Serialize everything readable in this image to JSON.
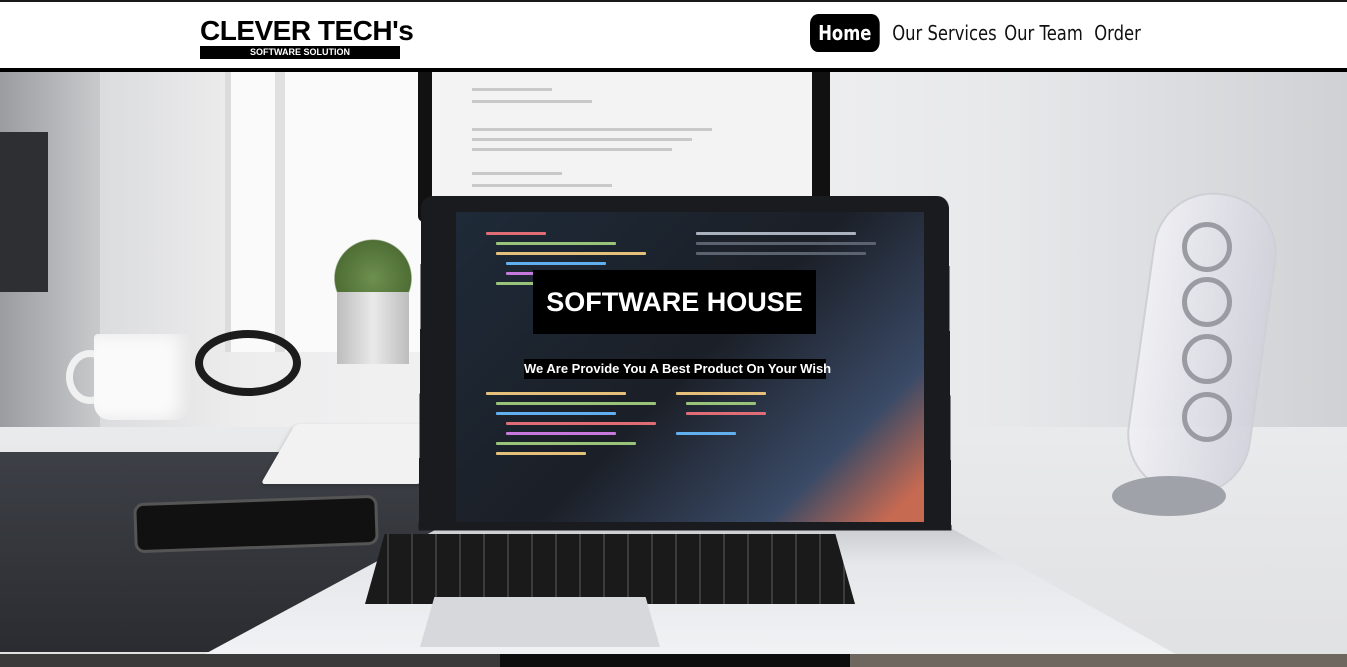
{
  "brand": {
    "title": "CLEVER TECH's",
    "tagline": "SOFTWARE SOLUTION"
  },
  "nav": {
    "items": [
      {
        "label": "Home",
        "active": true
      },
      {
        "label": "Our Services",
        "active": false
      },
      {
        "label": "Our Team",
        "active": false
      },
      {
        "label": "Order",
        "active": false
      }
    ]
  },
  "hero": {
    "title": "SOFTWARE HOUSE",
    "subtitle": "We Are Provide You A Best Product On Your Wish"
  },
  "colors": {
    "brand": "#000000",
    "background": "#ffffff",
    "active_nav_text": "#ffffff"
  }
}
